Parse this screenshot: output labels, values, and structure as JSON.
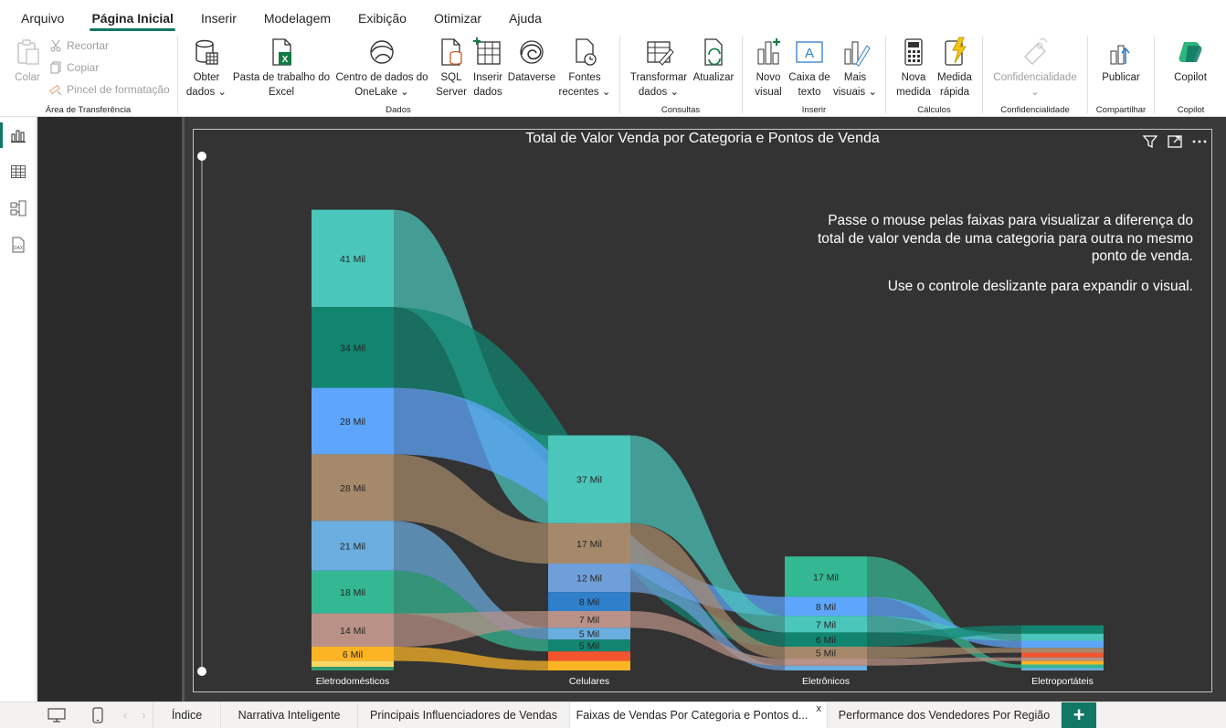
{
  "menu": [
    "Arquivo",
    "Página Inicial",
    "Inserir",
    "Modelagem",
    "Exibição",
    "Otimizar",
    "Ajuda"
  ],
  "ribbon": {
    "clipboard": {
      "paste": "Colar",
      "cut": "Recortar",
      "copy": "Copiar",
      "format_painter": "Pincel de formatação",
      "label": "Área de Transferência"
    },
    "data": {
      "get_data": [
        "Obter",
        "dados ⌄"
      ],
      "excel": [
        "Pasta de trabalho do",
        "Excel"
      ],
      "onelake": [
        "Centro de dados do",
        "OneLake ⌄"
      ],
      "sql": [
        "SQL",
        "Server"
      ],
      "enter_data": [
        "Inserir",
        "dados"
      ],
      "dataverse": [
        "Dataverse",
        ""
      ],
      "recent": [
        "Fontes",
        "recentes ⌄"
      ],
      "label": "Dados"
    },
    "queries": {
      "transform": [
        "Transformar",
        "dados ⌄"
      ],
      "refresh": [
        "Atualizar",
        ""
      ],
      "label": "Consultas"
    },
    "insert": {
      "new_visual": [
        "Novo",
        "visual"
      ],
      "text_box": [
        "Caixa de",
        "texto"
      ],
      "more_visuals": [
        "Mais",
        "visuais ⌄"
      ],
      "label": "Inserir"
    },
    "calc": {
      "new_measure": [
        "Nova",
        "medida"
      ],
      "quick_measure": [
        "Medida",
        "rápida"
      ],
      "label": "Cálculos"
    },
    "sensitivity": {
      "button": [
        "Confidencialidade",
        "⌄"
      ],
      "label": "Confidencialidade"
    },
    "share": {
      "publish": [
        "Publicar",
        ""
      ],
      "label": "Compartilhar"
    },
    "copilot": {
      "button": [
        "Copilot",
        ""
      ],
      "label": "Copilot"
    }
  },
  "visual": {
    "title": "Total de Valor Venda por Categoria e Pontos de Venda",
    "hint1": "Passe o mouse pelas faixas para visualizar a diferença do total de valor venda de uma categoria para outra no mesmo ponto de venda.",
    "hint2": "Use o controle deslizante para expandir o visual."
  },
  "tabs": [
    "Índice",
    "Narrativa Inteligente",
    "Principais Influenciadores de Vendas",
    "Faixas de Vendas Por Categoria e Pontos d...",
    "Performance dos Vendedores Por Região"
  ],
  "add_tab": "+",
  "close_tab": "x",
  "chart_data": {
    "type": "ribbon",
    "categories": [
      "Eletrodomésticos",
      "Celulares",
      "Eletrônicos",
      "Eletroportáteis"
    ],
    "columns": [
      {
        "name": "Eletrodomésticos",
        "segments": [
          {
            "label": "41 Mil",
            "value": 41,
            "color": "#4ac6bb"
          },
          {
            "label": "34 Mil",
            "value": 34,
            "color": "#118570"
          },
          {
            "label": "28 Mil",
            "value": 28,
            "color": "#5ea6fd"
          },
          {
            "label": "28 Mil",
            "value": 28,
            "color": "#a6896b"
          },
          {
            "label": "21 Mil",
            "value": 21,
            "color": "#6aaddf"
          },
          {
            "label": "18 Mil",
            "value": 18,
            "color": "#34b893"
          },
          {
            "label": "14 Mil",
            "value": 14,
            "color": "#b99186"
          },
          {
            "label": "6 Mil",
            "value": 6,
            "color": "#fcb425"
          },
          {
            "label": "",
            "value": 2.5,
            "color": "#f6d664"
          },
          {
            "label": "",
            "value": 1.5,
            "color": "#2f9970"
          }
        ]
      },
      {
        "name": "Celulares",
        "segments": [
          {
            "label": "37 Mil",
            "value": 37,
            "color": "#4ac6bb"
          },
          {
            "label": "17 Mil",
            "value": 17,
            "color": "#a6896b"
          },
          {
            "label": "12 Mil",
            "value": 12,
            "color": "#6e9fd8"
          },
          {
            "label": "8 Mil",
            "value": 8,
            "color": "#2f7fcb"
          },
          {
            "label": "7 Mil",
            "value": 7,
            "color": "#b99186"
          },
          {
            "label": "5 Mil",
            "value": 5,
            "color": "#6aaddf"
          },
          {
            "label": "5 Mil",
            "value": 5,
            "color": "#118570"
          },
          {
            "label": "",
            "value": 4,
            "color": "#f4552f"
          },
          {
            "label": "",
            "value": 4,
            "color": "#fcb425"
          }
        ]
      },
      {
        "name": "Eletrônicos",
        "segments": [
          {
            "label": "17 Mil",
            "value": 17,
            "color": "#34b893"
          },
          {
            "label": "8 Mil",
            "value": 8,
            "color": "#5ea6fd"
          },
          {
            "label": "7 Mil",
            "value": 7,
            "color": "#4ac6bb"
          },
          {
            "label": "6 Mil",
            "value": 6,
            "color": "#118570"
          },
          {
            "label": "5 Mil",
            "value": 5,
            "color": "#a6896b"
          },
          {
            "label": "",
            "value": 3,
            "color": "#b99186"
          },
          {
            "label": "",
            "value": 2,
            "color": "#6aaddf"
          }
        ]
      },
      {
        "name": "Eletroportáteis",
        "segments": [
          {
            "label": "",
            "value": 3.5,
            "color": "#118570"
          },
          {
            "label": "",
            "value": 3,
            "color": "#4ac6bb"
          },
          {
            "label": "",
            "value": 3,
            "color": "#5ea6fd"
          },
          {
            "label": "",
            "value": 2,
            "color": "#a6896b"
          },
          {
            "label": "",
            "value": 2,
            "color": "#f4552f"
          },
          {
            "label": "",
            "value": 1.5,
            "color": "#b99186"
          },
          {
            "label": "",
            "value": 1.5,
            "color": "#fcb425"
          },
          {
            "label": "",
            "value": 1.5,
            "color": "#34b893"
          },
          {
            "label": "",
            "value": 1,
            "color": "#6aaddf"
          }
        ]
      }
    ],
    "ribbons": [
      {
        "from": [
          0,
          0
        ],
        "to": [
          1,
          0
        ],
        "color": "#4ac6bb"
      },
      {
        "from": [
          0,
          1
        ],
        "to": [
          2,
          3
        ],
        "color": "#118570"
      },
      {
        "from": [
          0,
          2
        ],
        "to": [
          2,
          1
        ],
        "color": "#5ea6fd"
      },
      {
        "from": [
          0,
          3
        ],
        "to": [
          1,
          1
        ],
        "color": "#a6896b"
      },
      {
        "from": [
          0,
          4
        ],
        "to": [
          1,
          5
        ],
        "color": "#6aaddf"
      },
      {
        "from": [
          0,
          5
        ],
        "to": [
          1,
          6
        ],
        "color": "#34b893"
      },
      {
        "from": [
          0,
          6
        ],
        "to": [
          1,
          4
        ],
        "color": "#b99186"
      },
      {
        "from": [
          0,
          7
        ],
        "to": [
          1,
          8
        ],
        "color": "#fcb425"
      },
      {
        "from": [
          1,
          0
        ],
        "to": [
          2,
          2
        ],
        "color": "#4ac6bb"
      },
      {
        "from": [
          1,
          1
        ],
        "to": [
          2,
          4
        ],
        "color": "#a6896b"
      },
      {
        "from": [
          1,
          2
        ],
        "to": [
          2,
          6
        ],
        "color": "#6e9fd8"
      },
      {
        "from": [
          1,
          4
        ],
        "to": [
          2,
          5
        ],
        "color": "#b99186"
      },
      {
        "from": [
          2,
          0
        ],
        "to": [
          3,
          7
        ],
        "color": "#34b893"
      },
      {
        "from": [
          2,
          1
        ],
        "to": [
          3,
          2
        ],
        "color": "#5ea6fd"
      },
      {
        "from": [
          2,
          2
        ],
        "to": [
          3,
          1
        ],
        "color": "#4ac6bb"
      },
      {
        "from": [
          2,
          3
        ],
        "to": [
          3,
          0
        ],
        "color": "#118570"
      },
      {
        "from": [
          2,
          4
        ],
        "to": [
          3,
          3
        ],
        "color": "#a6896b"
      },
      {
        "from": [
          2,
          5
        ],
        "to": [
          3,
          5
        ],
        "color": "#b99186"
      }
    ]
  }
}
